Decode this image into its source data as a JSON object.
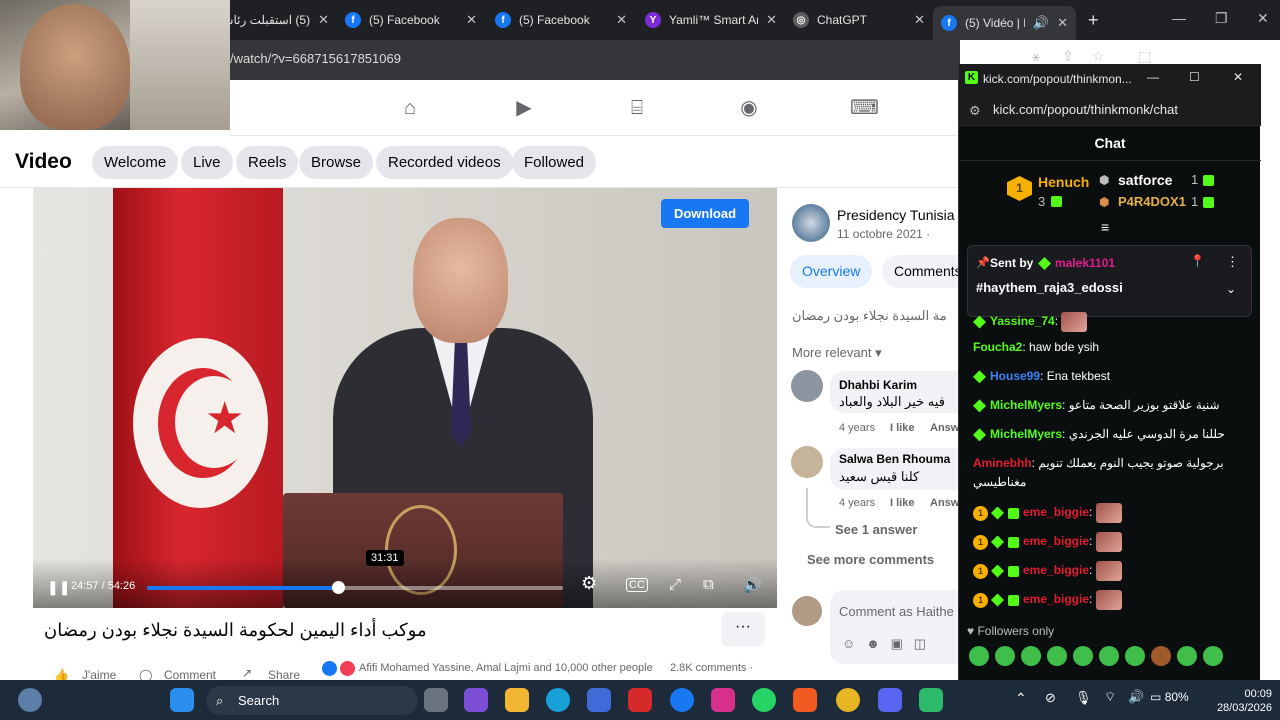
{
  "browser": {
    "tabs": [
      {
        "title": "(5) استقبلت رئاسة",
        "favicon": "facebook"
      },
      {
        "title": "(5) Facebook",
        "favicon": "facebook"
      },
      {
        "title": "(5) Facebook",
        "favicon": "facebook"
      },
      {
        "title": "Yamli™ Smart Ar",
        "favicon": "yamli"
      },
      {
        "title": "ChatGPT",
        "favicon": "chatgpt"
      },
      {
        "title": "(5) Vidéo | Fa",
        "favicon": "facebook"
      }
    ],
    "url": "/watch/?v=668715617851069"
  },
  "facebook": {
    "video_header": {
      "title": "Video",
      "pills": [
        "Welcome",
        "Live",
        "Reels",
        "Browse",
        "Recorded videos",
        "Followed"
      ]
    },
    "player": {
      "download_label": "Download",
      "time_display": "24:57 / 54:26",
      "hover_time": "31:31",
      "progress_fraction": 0.458,
      "hover_fraction": 0.579
    },
    "caption": "موكب أداء اليمين لحكومة السيدة نجلاء بودن رمضان",
    "more_label": "···",
    "reactions": {
      "like_label": "J'aime",
      "comment_label": "Comment",
      "share_label": "Share",
      "summary": "Afifi Mohamed Yassine, Amal Lajmi and 10,000 other people",
      "comments_count": "2.8K comments ·"
    },
    "side": {
      "page_name": "Presidency Tunisia",
      "date": "11 octobre 2021 ·",
      "tabs": [
        "Overview",
        "Comments"
      ],
      "description": "مة السيدة نجلاء بودن رمضان",
      "more_relevant": "More relevant",
      "comments": [
        {
          "author": "Dhahbi Karim",
          "text": "فيه خير البلاد والعباد",
          "age": "4 years",
          "like": "I like",
          "answer": "Answ"
        },
        {
          "author": "Salwa Ben Rhouma",
          "text": "كلنا قيس سعيد",
          "age": "4 years",
          "like": "I like",
          "answer": "Answ"
        }
      ],
      "see_answer": "See 1 answer",
      "see_more": "See more comments",
      "comment_placeholder": "Comment as Haithe"
    }
  },
  "kick": {
    "window_title": "kick.com/popout/thinkmon...",
    "url": "kick.com/popout/thinkmonk/chat",
    "chat_title": "Chat",
    "leaderboard": [
      {
        "name": "Henuch",
        "count": "3"
      },
      {
        "name": "satforce",
        "count": "1"
      },
      {
        "name": "P4R4DOX1",
        "count": "1"
      }
    ],
    "pinned": {
      "sent_by_label": "Sent by",
      "user": "malek1101",
      "text": "#haythem_raja3_edossi"
    },
    "messages": [
      {
        "user": "Yassine_74",
        "text": "",
        "color": "#53fc18"
      },
      {
        "user": "Foucha2",
        "text": "haw bde ysih",
        "color": "#53fc18"
      },
      {
        "user": "House99",
        "text": "Ena tekbest",
        "color": "#3b82f6"
      },
      {
        "user": "MichelMyers",
        "text": "شنية علاقتو بوزير الصحة متاعو",
        "color": "#53fc18"
      },
      {
        "user": "MichelMyers",
        "text": "حللنا مرة الدوسي عليه الجرندي",
        "color": "#53fc18"
      },
      {
        "user": "Aminebhh",
        "text": "برجولية صوتو يجيب النوم يعملك تنويم",
        "color": "#e11d2e"
      },
      {
        "user": "",
        "text": "مغناطيسي",
        "color": "#ffffff"
      },
      {
        "user": "eme_biggie",
        "text": "",
        "color": "#e11d2e"
      },
      {
        "user": "eme_biggie",
        "text": "",
        "color": "#e11d2e"
      },
      {
        "user": "eme_biggie",
        "text": "",
        "color": "#e11d2e"
      },
      {
        "user": "eme_biggie",
        "text": "",
        "color": "#e11d2e"
      }
    ],
    "followers_only": "Followers only"
  },
  "taskbar": {
    "search_label": "Search",
    "battery": "80%",
    "time": "00:09",
    "date": "28/03/2026"
  },
  "colors": {
    "facebook_blue": "#1877f2",
    "kick_green": "#53fc18"
  }
}
